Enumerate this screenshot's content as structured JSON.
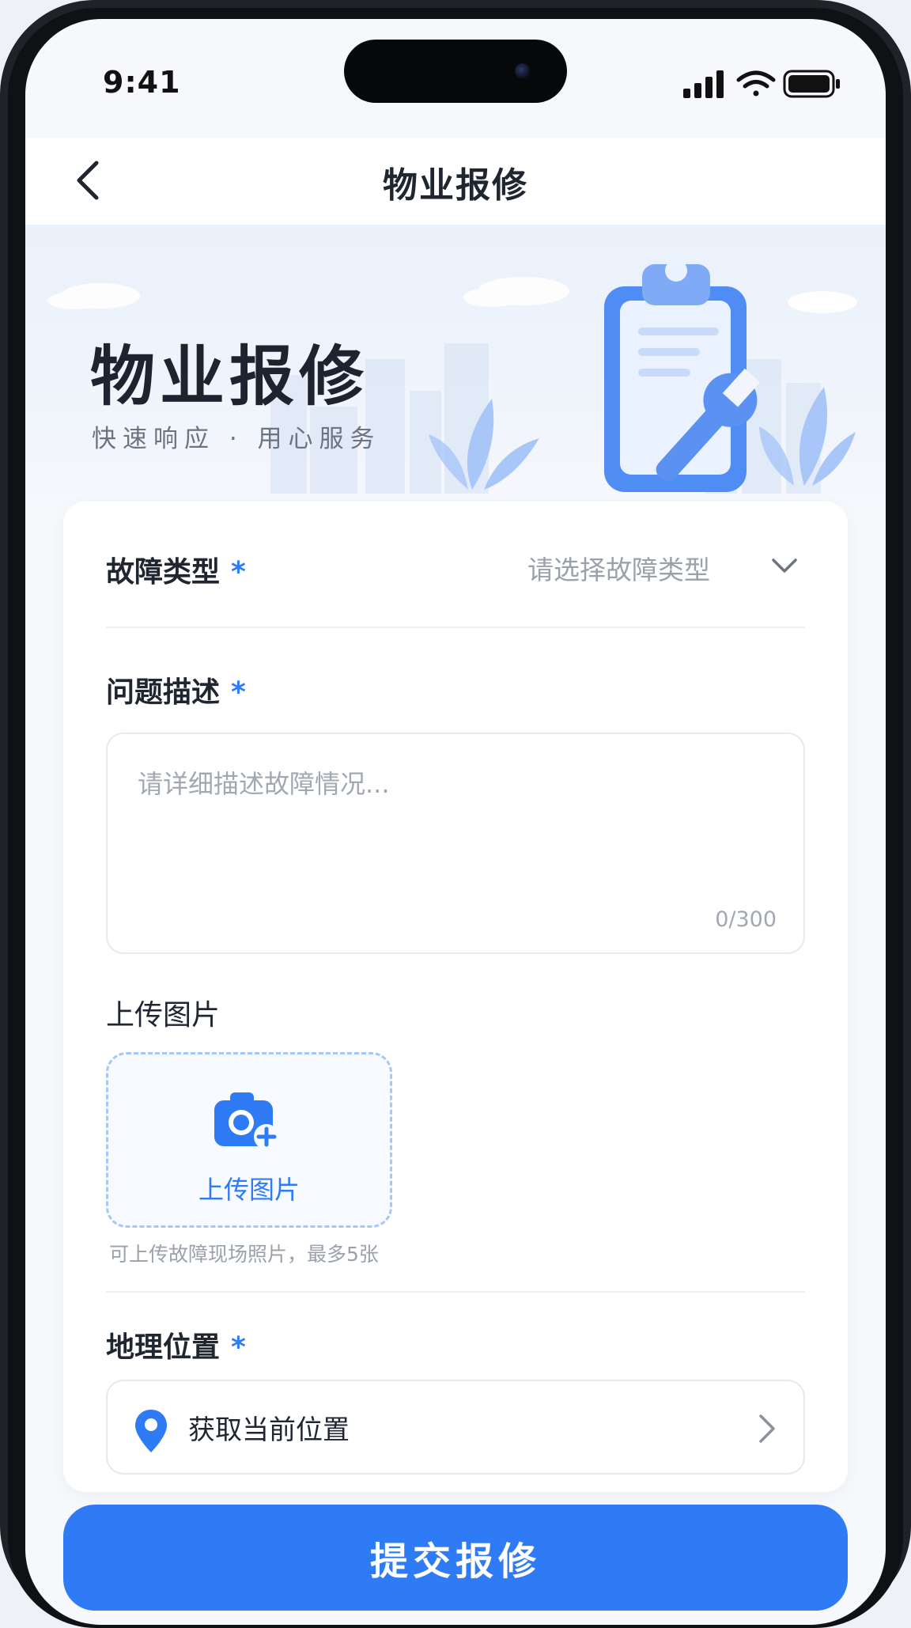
{
  "status_bar": {
    "time": "9:41"
  },
  "nav": {
    "title": "物业报修"
  },
  "hero": {
    "title": "物业报修",
    "subtitle": "快速响应 · 用心服务"
  },
  "form": {
    "fault_type": {
      "label": "故障类型",
      "required_mark": "*",
      "placeholder": "请选择故障类型"
    },
    "description": {
      "label": "问题描述",
      "required_mark": "*",
      "placeholder": "请详细描述故障情况...",
      "counter": "0/300"
    },
    "upload": {
      "label": "上传图片",
      "button_label": "上传图片",
      "hint": "可上传故障现场照片，最多5张"
    },
    "location": {
      "label": "地理位置",
      "required_mark": "*",
      "value": "获取当前位置"
    }
  },
  "submit": {
    "label": "提交报修"
  },
  "colors": {
    "accent": "#2f7bf5",
    "text": "#1f2630",
    "placeholder": "#9aa1aa"
  }
}
